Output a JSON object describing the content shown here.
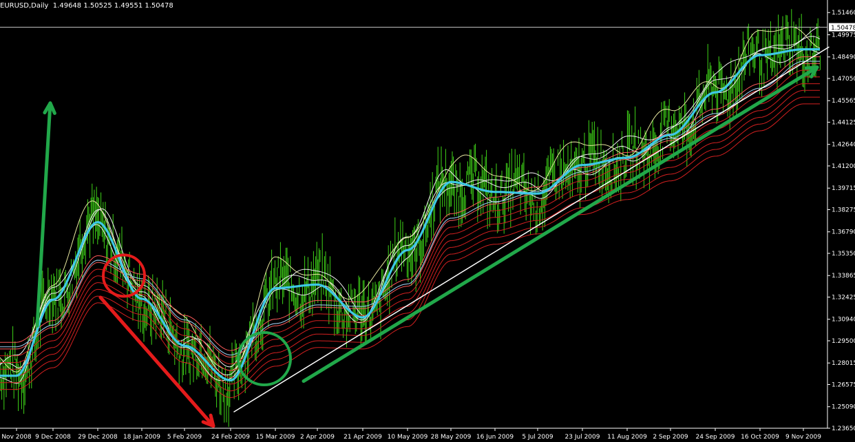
{
  "header": {
    "symbol": "EURUSD,Daily",
    "ohlc": "1.49648 1.50525 1.49551 1.50478"
  },
  "chart_data": {
    "type": "line",
    "title": "EURUSD,Daily 1.49648 1.50525 1.49551 1.50478",
    "ylim": [
      1.2365,
      1.523
    ],
    "current_price": "1.50478",
    "current_price_value": 1.50478,
    "y_ticks": [
      {
        "label": "1.51460",
        "value": 1.5146
      },
      {
        "label": "1.49975",
        "value": 1.49975
      },
      {
        "label": "1.48490",
        "value": 1.4849
      },
      {
        "label": "1.47050",
        "value": 1.4705
      },
      {
        "label": "1.45565",
        "value": 1.45565
      },
      {
        "label": "1.44125",
        "value": 1.44125
      },
      {
        "label": "1.42640",
        "value": 1.4264
      },
      {
        "label": "1.41200",
        "value": 1.412
      },
      {
        "label": "1.39715",
        "value": 1.39715
      },
      {
        "label": "1.38275",
        "value": 1.38275
      },
      {
        "label": "1.36790",
        "value": 1.3679
      },
      {
        "label": "1.35350",
        "value": 1.3535
      },
      {
        "label": "1.33865",
        "value": 1.33865
      },
      {
        "label": "1.32425",
        "value": 1.32425
      },
      {
        "label": "1.30940",
        "value": 1.3094
      },
      {
        "label": "1.29500",
        "value": 1.295
      },
      {
        "label": "1.28015",
        "value": 1.28015
      },
      {
        "label": "1.26575",
        "value": 1.26575
      },
      {
        "label": "1.25090",
        "value": 1.2509
      },
      {
        "label": "1.23650",
        "value": 1.2365
      }
    ],
    "x_ticks": [
      "Nov 2008",
      "9 Dec 2008",
      "29 Dec 2008",
      "18 Jan 2009",
      "5 Feb 2009",
      "24 Feb 2009",
      "15 Mar 2009",
      "2 Apr 2009",
      "21 Apr 2009",
      "10 May 2009",
      "28 May 2009",
      "16 Jun 2009",
      "5 Jul 2009",
      "23 Jul 2009",
      "11 Aug 2009",
      "2 Sep 2009",
      "24 Sep 2009",
      "16 Oct 2009",
      "9 Nov 2009"
    ],
    "series": [
      {
        "style": "cyan",
        "x": [
          "Nov 2008",
          "9 Dec 2008",
          "29 Dec 2008",
          "18 Jan 2009",
          "5 Feb 2009",
          "24 Feb 2009",
          "15 Mar 2009",
          "2 Apr 2009",
          "21 Apr 2009",
          "10 May 2009",
          "28 May 2009",
          "16 Jun 2009",
          "5 Jul 2009",
          "23 Jul 2009",
          "11 Aug 2009",
          "2 Sep 2009",
          "24 Sep 2009",
          "16 Oct 2009",
          "9 Nov 2009"
        ],
        "values": [
          1.2716,
          1.3225,
          1.3744,
          1.3231,
          1.2917,
          1.2685,
          1.3302,
          1.3326,
          1.3106,
          1.3557,
          1.4013,
          1.3946,
          1.3935,
          1.4126,
          1.4175,
          1.4328,
          1.4612,
          1.4861,
          1.49
        ]
      },
      {
        "style": "red",
        "x": [
          "Nov 2008",
          "9 Dec 2008",
          "29 Dec 2008",
          "18 Jan 2009",
          "5 Feb 2009",
          "24 Feb 2009",
          "15 Mar 2009",
          "2 Apr 2009",
          "21 Apr 2009",
          "10 May 2009",
          "28 May 2009",
          "16 Jun 2009",
          "5 Jul 2009",
          "23 Jul 2009",
          "11 Aug 2009",
          "2 Sep 2009",
          "24 Sep 2009",
          "16 Oct 2009",
          "9 Nov 2009"
        ],
        "values": [
          1.282,
          1.2965,
          1.3399,
          1.3276,
          1.3,
          1.2765,
          1.2975,
          1.31,
          1.309,
          1.324,
          1.368,
          1.3791,
          1.386,
          1.399,
          1.409,
          1.4215,
          1.438,
          1.455,
          1.473
        ]
      }
    ],
    "annotations": [
      {
        "type": "arrow",
        "color": "#21a84a",
        "from": [
          "9 Dec 2008",
          1.305
        ],
        "to": [
          "9 Dec 2008",
          1.454
        ]
      },
      {
        "type": "arrow",
        "color": "#e41b1b",
        "from": [
          "29 Dec 2008",
          1.324
        ],
        "to": [
          "24 Feb 2009",
          1.238
        ]
      },
      {
        "type": "circle",
        "color": "#e41b1b",
        "center": [
          "18 Jan 2009",
          1.3386
        ]
      },
      {
        "type": "circle",
        "color": "#21a84a",
        "center": [
          "15 Mar 2009",
          1.283
        ]
      },
      {
        "type": "line",
        "color": "#ffffff",
        "from": [
          "24 Feb 2009",
          1.2475
        ],
        "to": [
          "9 Nov 2009",
          1.4915
        ]
      },
      {
        "type": "arrow",
        "color": "#21a84a",
        "from": [
          "2 Apr 2009",
          1.268
        ],
        "to": [
          "9 Nov 2009",
          1.478
        ]
      }
    ]
  }
}
